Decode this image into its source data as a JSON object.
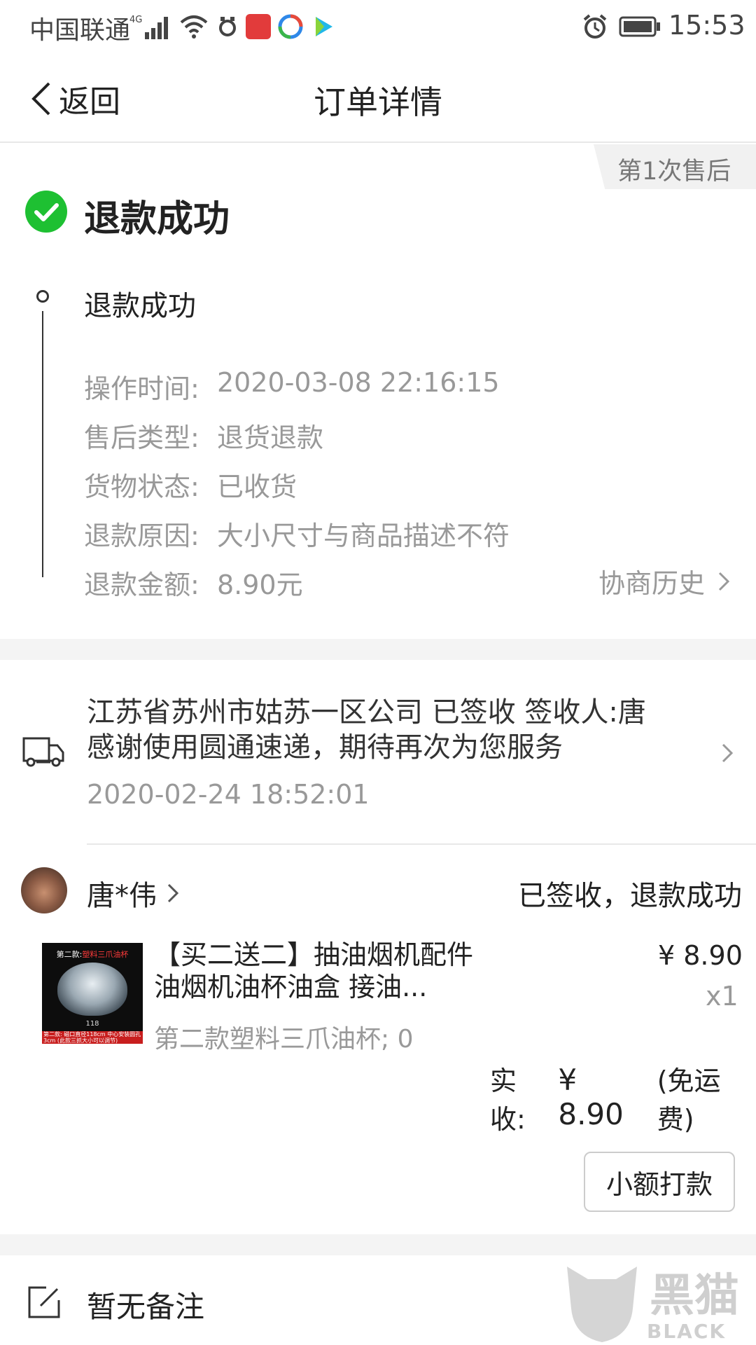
{
  "status_bar": {
    "carrier": "中国联通",
    "network": "4G",
    "time": "15:53",
    "icons_left": [
      "signal-icon",
      "wifi-icon",
      "notification-app-icon",
      "red-app-icon",
      "browser-app-icon",
      "video-app-icon"
    ],
    "icons_right": [
      "alarm-icon",
      "battery-icon"
    ]
  },
  "nav": {
    "back_label": "返回",
    "title": "订单详情"
  },
  "aftersale": {
    "tag": "第1次售后",
    "status_title": "退款成功",
    "status_color": "#1ec032",
    "timeline_title": "退款成功",
    "details": [
      {
        "label": "操作时间:",
        "value": "2020-03-08 22:16:15"
      },
      {
        "label": "售后类型:",
        "value": "退货退款"
      },
      {
        "label": "货物状态:",
        "value": "已收货"
      },
      {
        "label": "退款原因:",
        "value": "大小尺寸与商品描述不符"
      },
      {
        "label": "退款金额:",
        "value": "8.90元"
      }
    ],
    "history_link": "协商历史"
  },
  "logistics": {
    "line1": "江苏省苏州市姑苏一区公司 已签收  签收人:唐",
    "line2": "感谢使用圆通速递，期待再次为您服务",
    "time": "2020-02-24 18:52:01"
  },
  "buyer": {
    "name": "唐*伟",
    "status": "已签收，退款成功"
  },
  "product": {
    "image_caption_prefix": "第二款:",
    "image_caption_highlight": "塑料三爪油杯",
    "image_size_text": "118",
    "image_bottom_text": "第二款: 磁口直径118cm 中心安装圆孔3cm (此款三抓大小可以调节)",
    "title": "【买二送二】抽油烟机配件 油烟机油杯油盒 接油...",
    "sku": "第二款塑料三爪油杯; 0",
    "price": "¥ 8.90",
    "qty": "x1"
  },
  "payment": {
    "label": "实收:",
    "amount": "¥ 8.90",
    "note": "(免运费)"
  },
  "actions": {
    "small_pay": "小额打款"
  },
  "remark": {
    "text": "暂无备注"
  },
  "watermark": {
    "cn": "黑猫",
    "en": "BLACK CAT"
  }
}
